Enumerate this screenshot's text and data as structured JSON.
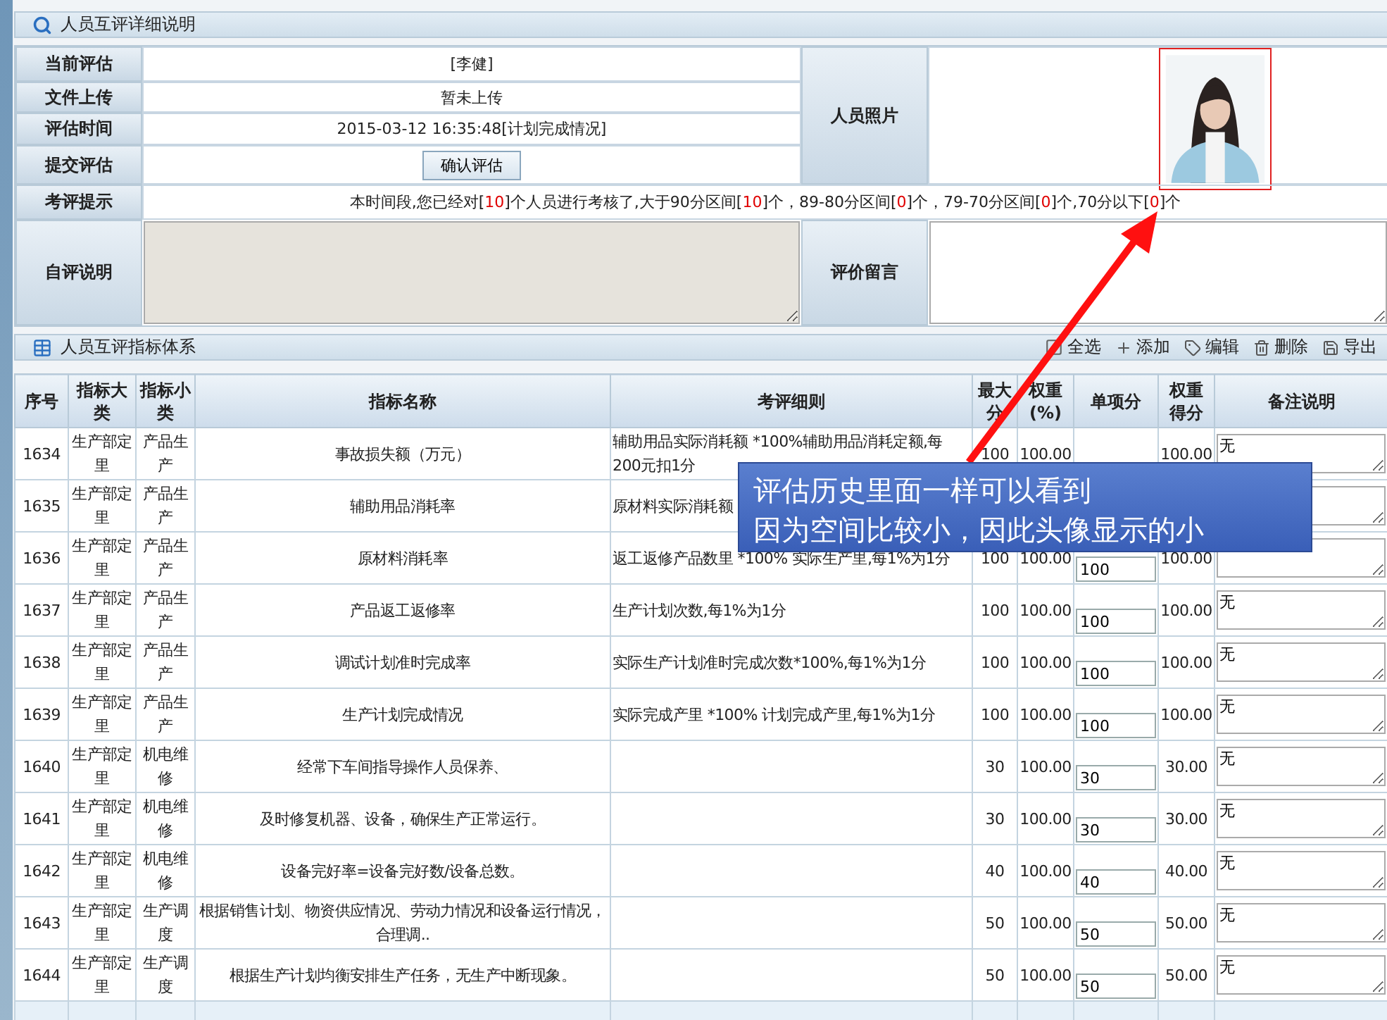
{
  "detail_panel": {
    "title": "人员互评详细说明"
  },
  "info": {
    "fields": [
      {
        "label": "当前评估",
        "value": "[李健]",
        "kind": "text"
      },
      {
        "label": "文件上传",
        "value": "暂未上传",
        "kind": "text"
      },
      {
        "label": "评估时间",
        "value": "2015-03-12 16:35:48[计划完成情况]",
        "kind": "text"
      },
      {
        "label": "提交评估",
        "value": "确认评估",
        "kind": "button"
      }
    ],
    "photo_label": "人员照片",
    "tip_label": "考评提示",
    "tip_parts": [
      {
        "text": "本时间段,您已经对[",
        "kind": "plain"
      },
      {
        "text": "10",
        "kind": "count"
      },
      {
        "text": "]个人员进行考核了,大于90分区间[",
        "kind": "plain"
      },
      {
        "text": "10",
        "kind": "count"
      },
      {
        "text": "]个，89-80分区间[",
        "kind": "plain"
      },
      {
        "text": "0",
        "kind": "count"
      },
      {
        "text": "]个，79-70分区间[",
        "kind": "plain"
      },
      {
        "text": "0",
        "kind": "count"
      },
      {
        "text": "]个,70分以下[",
        "kind": "plain"
      },
      {
        "text": "0",
        "kind": "count"
      },
      {
        "text": "]个",
        "kind": "plain"
      }
    ],
    "self_label": "自评说明",
    "comment_label": "评价留言"
  },
  "index_panel": {
    "title": "人员互评指标体系",
    "actions": [
      {
        "label": "全选",
        "kind": "checkbox",
        "checked": false
      },
      {
        "label": "添加",
        "kind": "add"
      },
      {
        "label": "编辑",
        "kind": "edit"
      },
      {
        "label": "删除",
        "kind": "delete"
      },
      {
        "label": "导出",
        "kind": "export"
      }
    ]
  },
  "table": {
    "columns": [
      "序号",
      "指标大类",
      "指标小类",
      "指标名称",
      "考评细则",
      "最大分",
      "权重(%)",
      "单项分",
      "权重得分",
      "备注说明"
    ],
    "rows": [
      {
        "no": "1634",
        "cat": "生产部定里",
        "sub": "产品生产",
        "name": "事故损失额（万元）",
        "rule": "辅助用品实际消耗额 *100%辅助用品消耗定额,每200元扣1分",
        "max": "100",
        "weight": "100.00",
        "weighted": "100.00",
        "remark": "无"
      },
      {
        "no": "1635",
        "cat": "生产部定里",
        "sub": "产品生产",
        "name": "辅助用品消耗率",
        "rule": "原材料实际消耗额"
      },
      {
        "no": "1636",
        "cat": "生产部定里",
        "sub": "产品生产",
        "name": "原材料消耗率",
        "rule": "返工返修产品数里 *100% 实际生产里,每1%为1分",
        "max": "100",
        "weight": "100.00",
        "score": "100",
        "weighted": "100.00"
      },
      {
        "no": "1637",
        "cat": "生产部定里",
        "sub": "产品生产",
        "name": "产品返工返修率",
        "rule": "生产计划次数,每1%为1分",
        "max": "100",
        "weight": "100.00",
        "score": "100",
        "weighted": "100.00",
        "remark": "无"
      },
      {
        "no": "1638",
        "cat": "生产部定里",
        "sub": "产品生产",
        "name": "调试计划准时完成率",
        "rule": "实际生产计划准时完成次数*100%,每1%为1分",
        "max": "100",
        "weight": "100.00",
        "score": "100",
        "weighted": "100.00",
        "remark": "无"
      },
      {
        "no": "1639",
        "cat": "生产部定里",
        "sub": "产品生产",
        "name": "生产计划完成情况",
        "rule": "实际完成产里 *100% 计划完成产里,每1%为1分",
        "max": "100",
        "weight": "100.00",
        "score": "100",
        "weighted": "100.00",
        "remark": "无"
      },
      {
        "no": "1640",
        "cat": "生产部定里",
        "sub": "机电维修",
        "name": "经常下车间指导操作人员保养、",
        "max": "30",
        "weight": "100.00",
        "score": "30",
        "weighted": "30.00",
        "remark": "无"
      },
      {
        "no": "1641",
        "cat": "生产部定里",
        "sub": "机电维修",
        "name": "及时修复机器、设备，确保生产正常运行。",
        "max": "30",
        "weight": "100.00",
        "score": "30",
        "weighted": "30.00",
        "remark": "无"
      },
      {
        "no": "1642",
        "cat": "生产部定里",
        "sub": "机电维修",
        "name": "设备完好率=设备完好数/设备总数。",
        "max": "40",
        "weight": "100.00",
        "score": "40",
        "weighted": "40.00",
        "remark": "无"
      },
      {
        "no": "1643",
        "cat": "生产部定里",
        "sub": "生产调度",
        "name": "根据销售计划、物资供应情况、劳动力情况和设备运行情况，合理调..",
        "max": "50",
        "weight": "100.00",
        "score": "50",
        "weighted": "50.00",
        "remark": "无"
      },
      {
        "no": "1644",
        "cat": "生产部定里",
        "sub": "生产调度",
        "name": "根据生产计划均衡安排生产任务，无生产中断现象。",
        "max": "50",
        "weight": "100.00",
        "score": "50",
        "weighted": "50.00",
        "remark": "无"
      }
    ]
  },
  "callout": {
    "lines": [
      "评估历史里面一样可以看到",
      "因为空间比较小，因此头像显示的小"
    ]
  }
}
